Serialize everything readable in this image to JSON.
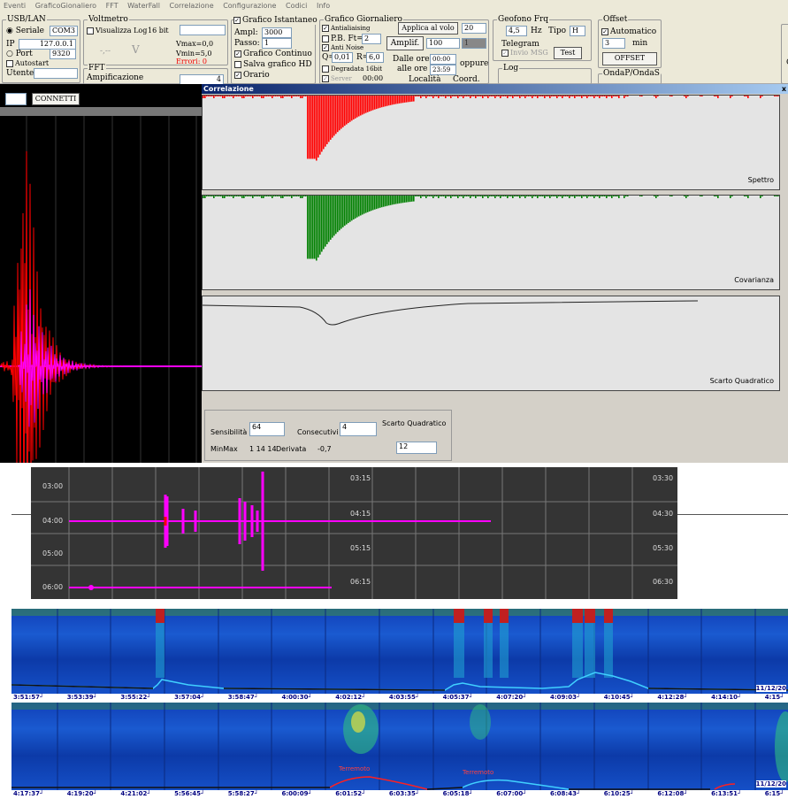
{
  "menu": [
    "Eventi",
    "GraficoGionaliero",
    "FFT",
    "WaterFall",
    "Correlazione",
    "Configurazione",
    "Codici",
    "Info"
  ],
  "usb_lan": {
    "title": "USB/LAN",
    "seriale": "Seriale",
    "com": "COM3",
    "ip_label": "IP",
    "ip": "127.0.0.1",
    "port_label": "Port",
    "port": "9320",
    "autostart": "Autostart",
    "utente": "Utente",
    "connect": "CONNETTI"
  },
  "voltmetro": {
    "title": "Voltmetro",
    "visualizza": "Visualizza Log",
    "bits": "16 bit",
    "vmax": "Vmax=0,0",
    "vmin": "Vmin=5,0",
    "errori": "Errori: 0",
    "dash": "-,--",
    "unit": "V"
  },
  "fft": {
    "title": "FFT",
    "amp": "Ampificazione",
    "value": "4"
  },
  "istantaneo": {
    "title": "Grafico Istantaneo",
    "ampl_label": "Ampl:",
    "ampl": "3000",
    "passo_label": "Passo:",
    "passo": "1",
    "continuo": "Grafico Continuo",
    "salva": "Salva grafico HD",
    "orario": "Orario"
  },
  "giornaliero": {
    "title": "Grafico Giornaliero",
    "antialiasing": "Antialiaising",
    "pb": "P.B. Ft=",
    "pb_val": "2",
    "antinoise": "Anti Noise",
    "q": "Q=",
    "q_val": "0,01",
    "r": "R=",
    "r_val": "6,0",
    "degradata": "Degradata 16bit",
    "server": "Server",
    "server_time": "00:00",
    "applica": "Applica al volo",
    "applica_val": "20",
    "amplif": "Amplif.",
    "amplif_val": "100",
    "amplif_val2": "1",
    "dalle": "Dalle ore",
    "dalle_val": "00:00",
    "alle": "alle ore",
    "alle_val": "23:59",
    "oppure": "oppure",
    "localita": "Località",
    "coord": "Coord."
  },
  "geofono": {
    "title": "Geofono Frq",
    "freq": "4,5",
    "hz": "Hz",
    "tipo": "Tipo",
    "tipo_val": "H",
    "telegram": "Telegram",
    "invio": "Invio MSG",
    "test": "Test",
    "log": "Log"
  },
  "offset": {
    "title": "Offset",
    "automatico": "Automatico",
    "min_val": "3",
    "min": "min",
    "btn": "OFFSET",
    "onda": "OndaP/OndaS",
    "g": "G"
  },
  "correlazione": {
    "title": "Correlazione",
    "close": "x",
    "panels": [
      "Spettro",
      "Covarianza",
      "Scarto Quadratico"
    ],
    "sensibilita": "Sensibilità",
    "sens_val": "64",
    "consecutivi": "Consecutivi",
    "cons_val": "4",
    "scarto": "Scarto Quadratico",
    "scarto_val": "12",
    "minmax": "MinMax",
    "minmax_val": "1 14 14",
    "derivata": "Derivata",
    "derivata_val": "-0,7"
  },
  "daily_chart": {
    "rows_left": [
      "03:00",
      "04:00",
      "05:00",
      "06:00"
    ],
    "rows_mid": [
      "03:15",
      "04:15",
      "05:15",
      "06:15"
    ],
    "rows_right": [
      "03:30",
      "04:30",
      "05:30",
      "06:30"
    ]
  },
  "waterfall_top": {
    "times": [
      "3:51:57",
      "3:53:39",
      "3:55:22",
      "3:57:04",
      "3:58:47",
      "4:00:30",
      "4:02:12",
      "4:03:55",
      "4:05:37",
      "4:07:20",
      "4:09:03",
      "4:10:45",
      "4:12:28",
      "4:14:10",
      "4:15"
    ],
    "date": "11/12/20"
  },
  "waterfall_bottom": {
    "times": [
      "4:17:37",
      "4:19:20",
      "4:21:02",
      "5:56:45",
      "5:58:27",
      "6:00:09",
      "6:01:52",
      "6:03:35",
      "6:05:18",
      "6:07:00",
      "6:08:43",
      "6:10:25",
      "6:12:08",
      "6:13:51",
      "6:15"
    ],
    "date": "11/12/20",
    "label1": "Terremoto",
    "label2": "Terremoto"
  },
  "colors": {
    "wave_red": "#ff0000",
    "wave_magenta": "#ff00ff",
    "spectrum_red": "#ff0000",
    "spectrum_green": "#008000",
    "wf_blue": "#1a4fc8"
  }
}
